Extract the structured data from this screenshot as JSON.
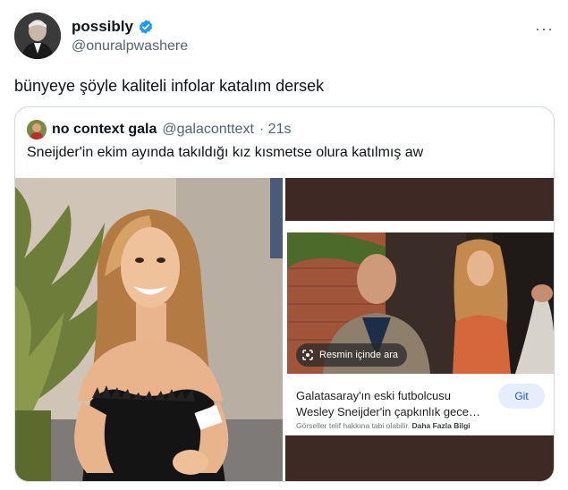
{
  "tweet": {
    "display_name": "possibly",
    "handle": "@onuralpwashere",
    "text": "bünyeye şöyle kaliteli infolar katalım dersek",
    "more_label": "···"
  },
  "quote": {
    "display_name": "no context gala",
    "handle": "@galaconttext",
    "time": "· 21s",
    "text": "Sneijder'in ekim ayında takıldığı kız kısmetse olura katılmış aw"
  },
  "search_card": {
    "lens_label": "Resmin içinde ara",
    "title_line1": "Galatasaray'ın eski futbolcusu",
    "title_line2": "Wesley Sneijder'in çapkınlık geces...",
    "go_label": "Git",
    "footer_text": "Görseller telif hakkına tabi olabilir.",
    "footer_link": "Daha Fazla Bilgi"
  },
  "colors": {
    "verified_blue": "#1d9bf0",
    "handle_gray": "#536471",
    "border": "#cfd9de",
    "go_button_bg": "#e6eefc",
    "go_button_text": "#1a56c4"
  },
  "icons": [
    "verified-badge-icon",
    "more-options-icon",
    "google-lens-icon"
  ]
}
